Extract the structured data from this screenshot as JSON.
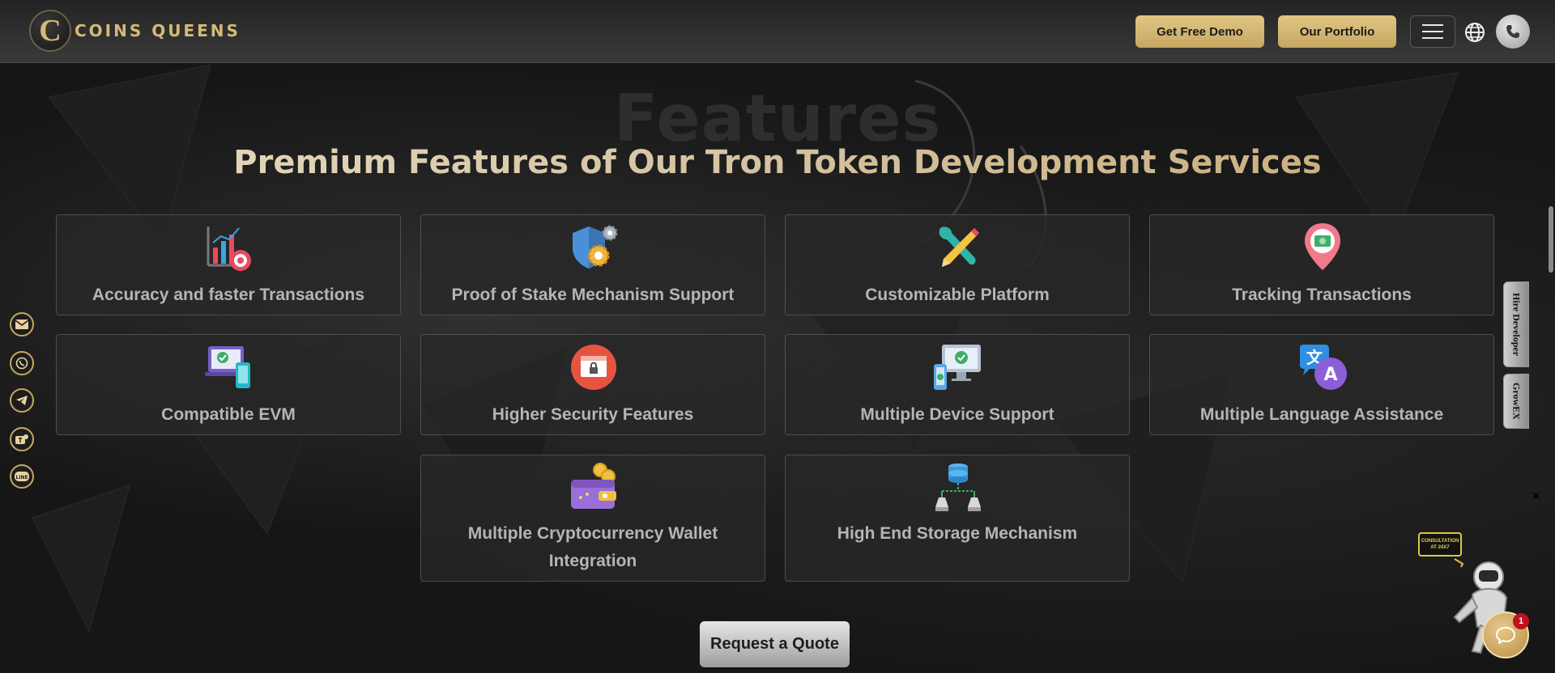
{
  "header": {
    "logo_letter": "C",
    "logo_text": "COINS QUEENS",
    "demo_label": "Get Free Demo",
    "portfolio_label": "Our Portfolio",
    "icons": [
      "menu-icon",
      "globe-icon",
      "phone-icon"
    ]
  },
  "section": {
    "ghost_title": "Features",
    "title": "Premium Features of Our Tron Token Development Services"
  },
  "features": [
    {
      "label": "Accuracy and faster Transactions",
      "icon": "analytics-target-icon"
    },
    {
      "label": "Proof of Stake Mechanism Support",
      "icon": "shield-gears-icon"
    },
    {
      "label": "Customizable Platform",
      "icon": "wrench-pencil-icon"
    },
    {
      "label": "Tracking Transactions",
      "icon": "location-pin-money-icon"
    },
    {
      "label": "Compatible EVM",
      "icon": "laptop-phone-check-icon"
    },
    {
      "label": "Higher Security Features",
      "icon": "browser-lock-icon"
    },
    {
      "label": "Multiple Device Support",
      "icon": "multi-device-check-icon"
    },
    {
      "label": "Multiple Language Assistance",
      "icon": "translate-icon"
    },
    {
      "label": "Multiple Cryptocurrency Wallet Integration",
      "icon": "wallet-coins-icon"
    },
    {
      "label": "High End Storage Mechanism",
      "icon": "database-network-icon"
    }
  ],
  "cta": {
    "quote_label": "Request a Quote"
  },
  "social": [
    "email-icon",
    "whatsapp-icon",
    "telegram-icon",
    "teams-icon",
    "line-icon"
  ],
  "side_tabs": {
    "hire": "Hire Developer",
    "growex": "GrowEX"
  },
  "chat": {
    "bubble_text": "CONSULTATION AT 24X7",
    "count": "1",
    "close": "×"
  },
  "colors": {
    "gold": "#d4b978",
    "background": "#161616",
    "card": "#282828",
    "badge": "#c2121b"
  }
}
